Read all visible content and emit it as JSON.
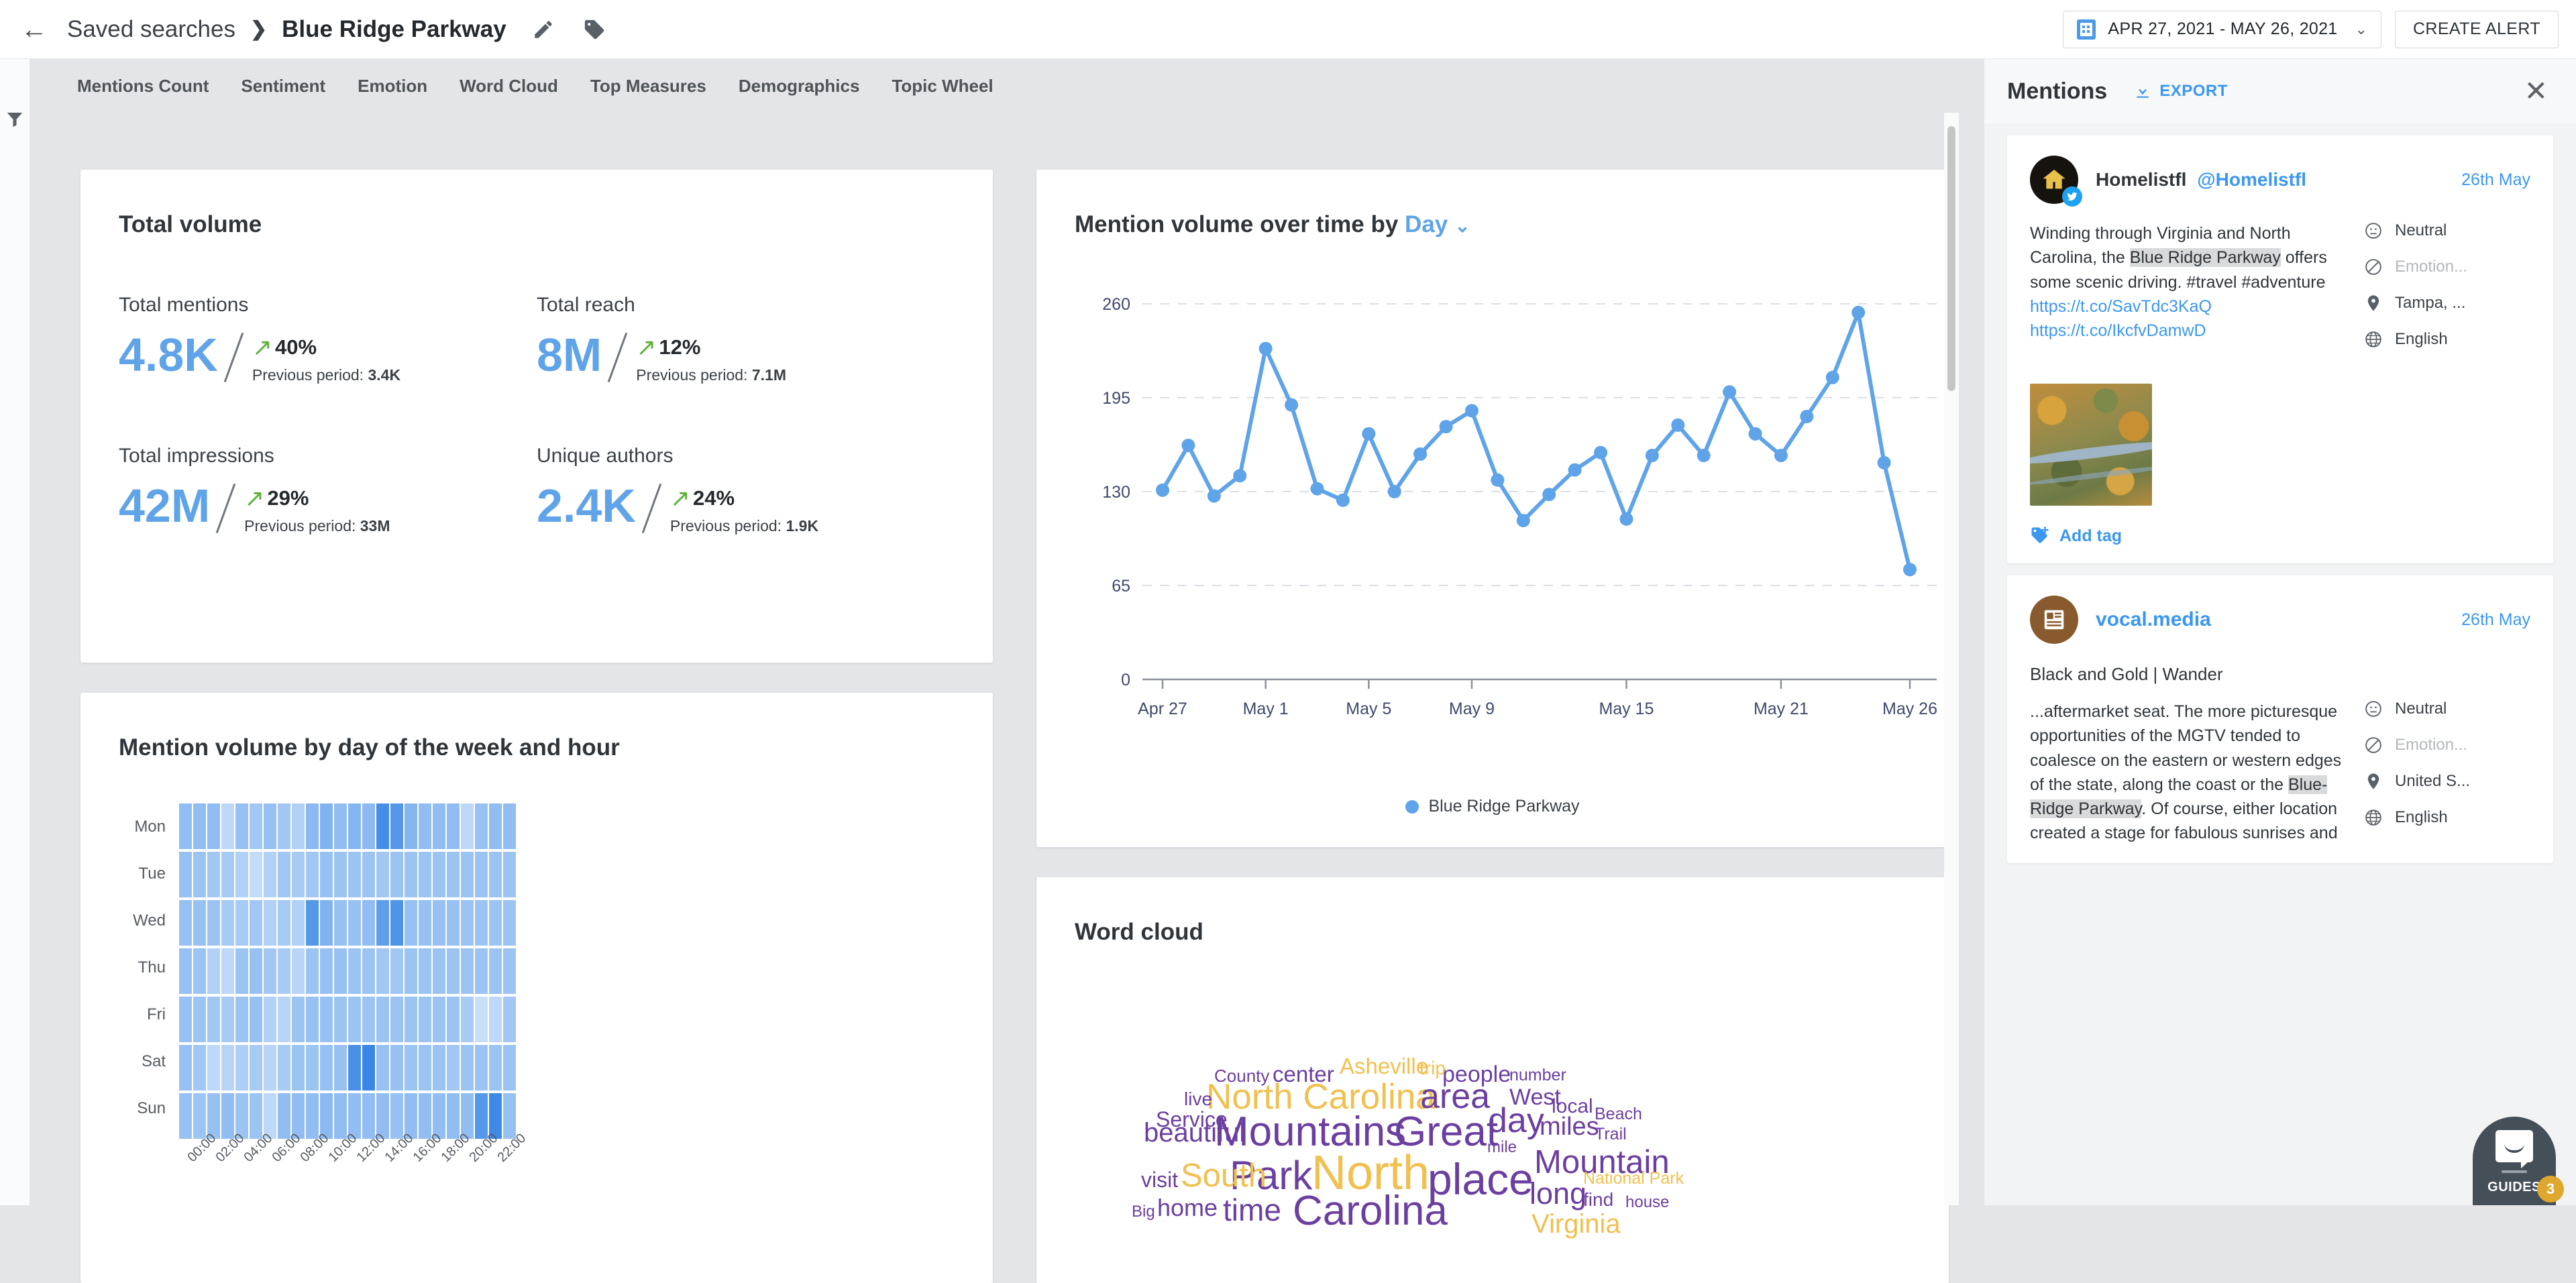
{
  "topbar": {
    "back_icon": "back-arrow-icon",
    "breadcrumb_root": "Saved searches",
    "breadcrumb_sep": "❯",
    "breadcrumb_current": "Blue Ridge Parkway",
    "edit_icon": "pencil-icon",
    "tag_icon": "tag-icon",
    "date_range": "APR 27, 2021 - MAY 26, 2021",
    "date_chevron": "⌄",
    "calendar_icon": "calendar-icon",
    "create_alert": "CREATE ALERT"
  },
  "tabs": [
    {
      "label": "Mentions Count"
    },
    {
      "label": "Sentiment"
    },
    {
      "label": "Emotion"
    },
    {
      "label": "Word Cloud"
    },
    {
      "label": "Top Measures"
    },
    {
      "label": "Demographics"
    },
    {
      "label": "Topic Wheel"
    }
  ],
  "filter_rail": {
    "icon": "funnel-filter-icon"
  },
  "total_volume": {
    "title": "Total volume",
    "metrics": [
      {
        "label": "Total mentions",
        "value": "4.8K",
        "delta": "40%",
        "delta_arrow": "↗",
        "previous_label": "Previous period:",
        "previous_value": "3.4K"
      },
      {
        "label": "Total reach",
        "value": "8M",
        "delta": "12%",
        "delta_arrow": "↗",
        "previous_label": "Previous period:",
        "previous_value": "7.1M"
      },
      {
        "label": "Total impressions",
        "value": "42M",
        "delta": "29%",
        "delta_arrow": "↗",
        "previous_label": "Previous period:",
        "previous_value": "33M"
      },
      {
        "label": "Unique authors",
        "value": "2.4K",
        "delta": "24%",
        "delta_arrow": "↗",
        "previous_label": "Previous period:",
        "previous_value": "1.9K"
      }
    ]
  },
  "line_card": {
    "title_prefix": "Mention volume over time by",
    "granularity": "Day",
    "chevron": "⌄"
  },
  "heatmap_card": {
    "title": "Mention volume by day of the week and hour"
  },
  "wordcloud_card": {
    "title": "Word cloud"
  },
  "mentions": {
    "title": "Mentions",
    "export_label": "EXPORT",
    "export_icon": "download-icon",
    "close_icon": "close-icon",
    "items": [
      {
        "author_name": "Homelistfl",
        "author_handle": "@Homelistfl",
        "source_icon": "twitter-icon",
        "date": "26th May",
        "text_pre": "Winding through Virginia and North Carolina, the ",
        "text_hl": "Blue Ridge Parkway",
        "text_post": " offers some scenic driving. #travel #adventure",
        "links": [
          "https://t.co/SavTdc3KaQ",
          "https://t.co/IkcfvDamwD"
        ],
        "sentiment": "Neutral",
        "emotion": "Emotion...",
        "location": "Tampa, ...",
        "language": "English",
        "sentiment_icon": "neutral-face-icon",
        "emotion_icon": "no-emotion-icon",
        "location_icon": "map-pin-icon",
        "language_icon": "globe-icon",
        "image_icon": "aerial-road-photo",
        "add_tag_label": "Add tag",
        "add_tag_icon": "add-tag-icon"
      },
      {
        "author_name": "vocal.media",
        "source_icon": "article-icon",
        "date": "26th May",
        "subject": "Black and Gold | Wander",
        "text_pre": "...aftermarket seat. The more picturesque opportunities of the MGTV tended to coalesce on the eastern or western edges of the state, along the coast or the ",
        "text_hl": "Blue-Ridge Parkway",
        "text_post": ". Of course, either location created a stage for fabulous sunrises and",
        "sentiment": "Neutral",
        "emotion": "Emotion...",
        "location": "United S...",
        "language": "English",
        "sentiment_icon": "neutral-face-icon",
        "emotion_icon": "no-emotion-icon",
        "location_icon": "map-pin-icon",
        "language_icon": "globe-icon"
      }
    ]
  },
  "guides": {
    "label": "GUIDES",
    "badge": "3",
    "icon": "chat-bubble-icon"
  },
  "colors": {
    "accent_blue": "#3b97f0",
    "metric_blue": "#5fa3e8",
    "positive_green": "#5fb23c",
    "wc_purple": "#6b3fa0",
    "wc_yellow": "#f0c050",
    "heat_base": "#68a8f5",
    "bg_gray": "#e3e5e8"
  },
  "chart_data": [
    {
      "type": "line",
      "title": "Mention volume over time by Day",
      "xlabel": "",
      "ylabel": "",
      "ylim": [
        0,
        260
      ],
      "yticks": [
        0,
        65,
        130,
        195,
        260
      ],
      "grid": true,
      "legend_position": "bottom",
      "series": [
        {
          "name": "Blue Ridge Parkway",
          "color": "#5fa3e8",
          "values": [
            131,
            162,
            127,
            141,
            229,
            190,
            132,
            124,
            170,
            130,
            156,
            175,
            186,
            138,
            110,
            128,
            145,
            157,
            111,
            155,
            176,
            155,
            199,
            170,
            155,
            182,
            209,
            254,
            150,
            76
          ]
        }
      ],
      "x": [
        "Apr 27",
        "Apr 28",
        "Apr 29",
        "Apr 30",
        "May 1",
        "May 2",
        "May 3",
        "May 4",
        "May 5",
        "May 6",
        "May 7",
        "May 8",
        "May 9",
        "May 10",
        "May 11",
        "May 12",
        "May 13",
        "May 14",
        "May 15",
        "May 16",
        "May 17",
        "May 18",
        "May 19",
        "May 20",
        "May 21",
        "May 22",
        "May 23",
        "May 24",
        "May 25",
        "May 26"
      ],
      "xticks": [
        "Apr 27",
        "May 1",
        "May 5",
        "May 9",
        "May 15",
        "May 21",
        "May 26"
      ]
    },
    {
      "type": "heatmap",
      "title": "Mention volume by day of the week and hour",
      "ylabel": "",
      "xlabel": "",
      "rows": [
        "Mon",
        "Tue",
        "Wed",
        "Thu",
        "Fri",
        "Sat",
        "Sun"
      ],
      "columns": [
        "00:00",
        "01:00",
        "02:00",
        "03:00",
        "04:00",
        "05:00",
        "06:00",
        "07:00",
        "08:00",
        "09:00",
        "10:00",
        "11:00",
        "12:00",
        "13:00",
        "14:00",
        "15:00",
        "16:00",
        "17:00",
        "18:00",
        "19:00",
        "20:00",
        "21:00",
        "22:00",
        "23:00"
      ],
      "xticks": [
        "00:00",
        "02:00",
        "04:00",
        "06:00",
        "08:00",
        "10:00",
        "12:00",
        "14:00",
        "16:00",
        "18:00",
        "20:00",
        "22:00"
      ],
      "values": [
        [
          52,
          52,
          52,
          36,
          50,
          46,
          50,
          46,
          40,
          54,
          58,
          52,
          56,
          54,
          80,
          74,
          56,
          52,
          52,
          52,
          36,
          50,
          52,
          52
        ],
        [
          50,
          48,
          46,
          44,
          40,
          34,
          40,
          46,
          44,
          46,
          50,
          48,
          48,
          48,
          46,
          48,
          48,
          48,
          48,
          48,
          48,
          48,
          48,
          48
        ],
        [
          50,
          50,
          48,
          44,
          44,
          46,
          40,
          44,
          40,
          74,
          58,
          50,
          50,
          52,
          70,
          76,
          50,
          50,
          50,
          50,
          48,
          48,
          48,
          48
        ],
        [
          50,
          48,
          40,
          36,
          48,
          50,
          46,
          44,
          38,
          48,
          50,
          50,
          48,
          48,
          46,
          46,
          48,
          48,
          48,
          48,
          48,
          48,
          48,
          48
        ],
        [
          50,
          48,
          46,
          44,
          48,
          50,
          40,
          38,
          48,
          50,
          50,
          48,
          48,
          48,
          48,
          48,
          48,
          48,
          48,
          48,
          44,
          32,
          36,
          46
        ],
        [
          50,
          46,
          36,
          38,
          42,
          44,
          38,
          44,
          48,
          48,
          50,
          50,
          78,
          84,
          50,
          50,
          48,
          48,
          48,
          46,
          48,
          48,
          48,
          48
        ],
        [
          50,
          48,
          50,
          52,
          48,
          48,
          36,
          52,
          52,
          52,
          54,
          52,
          52,
          52,
          52,
          50,
          52,
          52,
          52,
          52,
          52,
          74,
          82,
          50
        ]
      ],
      "color_low": "#d3e6fb",
      "color_high": "#3d8ae8"
    },
    {
      "type": "wordcloud",
      "title": "Word cloud",
      "words": [
        {
          "text": "North",
          "weight": 100,
          "color": "#f0c050"
        },
        {
          "text": "place",
          "weight": 97,
          "color": "#6b3fa0"
        },
        {
          "text": "Mountains",
          "weight": 88,
          "color": "#6b3fa0"
        },
        {
          "text": "Park",
          "weight": 86,
          "color": "#6b3fa0"
        },
        {
          "text": "North Carolina",
          "weight": 78,
          "color": "#f0c050"
        },
        {
          "text": "Great",
          "weight": 78,
          "color": "#6b3fa0"
        },
        {
          "text": "Carolina",
          "weight": 84,
          "color": "#6b3fa0"
        },
        {
          "text": "South",
          "weight": 70,
          "color": "#f0c050"
        },
        {
          "text": "time",
          "weight": 68,
          "color": "#6b3fa0"
        },
        {
          "text": "Mountain",
          "weight": 62,
          "color": "#6b3fa0"
        },
        {
          "text": "area",
          "weight": 62,
          "color": "#6b3fa0"
        },
        {
          "text": "day",
          "weight": 58,
          "color": "#6b3fa0"
        },
        {
          "text": "long",
          "weight": 56,
          "color": "#6b3fa0"
        },
        {
          "text": "beautiful",
          "weight": 50,
          "color": "#6b3fa0"
        },
        {
          "text": "miles",
          "weight": 48,
          "color": "#6b3fa0"
        },
        {
          "text": "home",
          "weight": 44,
          "color": "#6b3fa0"
        },
        {
          "text": "Service",
          "weight": 40,
          "color": "#6b3fa0"
        },
        {
          "text": "West",
          "weight": 38,
          "color": "#6b3fa0"
        },
        {
          "text": "people",
          "weight": 38,
          "color": "#6b3fa0"
        },
        {
          "text": "center",
          "weight": 38,
          "color": "#6b3fa0"
        },
        {
          "text": "local",
          "weight": 36,
          "color": "#6b3fa0"
        },
        {
          "text": "visit",
          "weight": 36,
          "color": "#6b3fa0"
        },
        {
          "text": "find",
          "weight": 36,
          "color": "#6b3fa0"
        },
        {
          "text": "Asheville",
          "weight": 34,
          "color": "#f0c050"
        },
        {
          "text": "Virginia",
          "weight": 40,
          "color": "#f0c050"
        },
        {
          "text": "County",
          "weight": 30,
          "color": "#6b3fa0"
        },
        {
          "text": "number",
          "weight": 28,
          "color": "#6b3fa0"
        },
        {
          "text": "trip",
          "weight": 28,
          "color": "#f0c050"
        },
        {
          "text": "live",
          "weight": 28,
          "color": "#6b3fa0"
        },
        {
          "text": "Beach",
          "weight": 26,
          "color": "#6b3fa0"
        },
        {
          "text": "Trail",
          "weight": 26,
          "color": "#6b3fa0"
        },
        {
          "text": "mile",
          "weight": 24,
          "color": "#6b3fa0"
        },
        {
          "text": "house",
          "weight": 24,
          "color": "#6b3fa0"
        },
        {
          "text": "National Park",
          "weight": 26,
          "color": "#f0c050"
        },
        {
          "text": "Big",
          "weight": 24,
          "color": "#6b3fa0"
        }
      ]
    }
  ]
}
